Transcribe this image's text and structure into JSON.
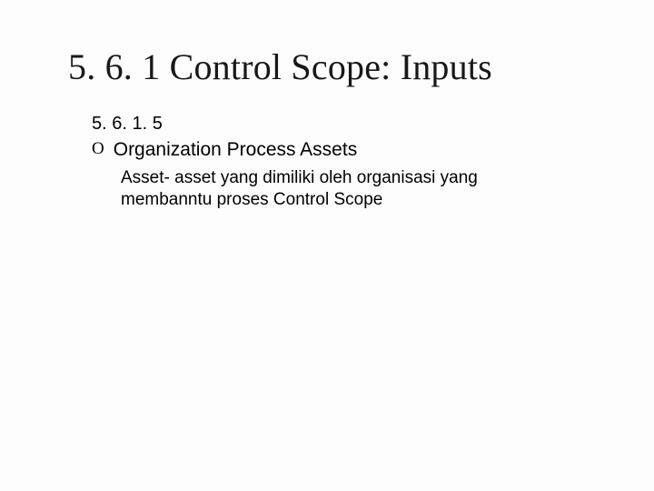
{
  "slide": {
    "title": "5. 6. 1 Control Scope: Inputs",
    "sub_number": "5. 6. 1. 5",
    "bullet_marker": "O",
    "bullet_label": "Organization Process Assets",
    "description": "Asset- asset yang dimiliki oleh organisasi yang membanntu proses Control Scope"
  }
}
